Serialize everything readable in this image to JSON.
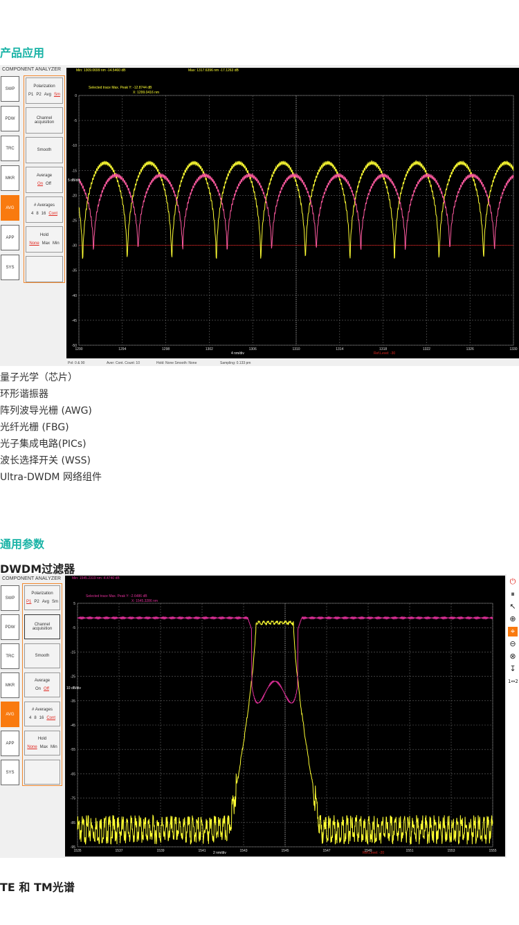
{
  "section_apps": "产品应用",
  "applications": [
    "量子光学（芯片）",
    "环形谐振器",
    "阵列波导光栅 (AWG)",
    "光纤光栅 (FBG)",
    "光子集成电路(PICs)",
    "波长选择开关 (WSS)",
    "Ultra-DWDM 网络组件"
  ],
  "section_params": "通用参数",
  "sub_dwdm": "DWDM过滤器",
  "sub_tetm": "TE 和 TM光谱",
  "app_title": "COMPONENT ANALYZER",
  "sidebar": [
    "SWP",
    "PDW",
    "TRC",
    "MKR",
    "AVG",
    "APP",
    "SYS"
  ],
  "colors": {
    "accent": "#f97a0f",
    "heading": "#19b3a6",
    "trace_yellow": "#ffff33",
    "trace_pink": "#ff5aa0",
    "trace_magenta": "#e2309a"
  },
  "screen1": {
    "controls": {
      "polarization": {
        "label": "Polarization",
        "options": [
          "P1",
          "P2",
          "Avg",
          "Sm"
        ],
        "selected": "Sm"
      },
      "channel": {
        "label": "Channel acquisition"
      },
      "smooth": {
        "label": "Smooth"
      },
      "average": {
        "label": "Average",
        "options": [
          "On",
          "Off"
        ],
        "selected": "On"
      },
      "averages": {
        "label": "# Averages",
        "options": [
          "4",
          "8",
          "16",
          "Cont"
        ],
        "selected": "Cont"
      },
      "hold": {
        "label": "Hold",
        "options": [
          "None",
          "Max",
          "Min"
        ],
        "selected": "None"
      }
    },
    "readout_min": "Min: 1309.0699 nm   -14.5460 dB",
    "readout_max": "Max: 1317.6396 nm   -17.1263 dB",
    "selected_line1": "Selected trace Max. Peak   Y: -12.8744 dB",
    "selected_line2": "X: 1299.0416 nm",
    "status_left": "Pol: 0 & 90",
    "status_aver": "Aver: Cont.   Count: 10",
    "status_hold": "Hold: None   Smooth: None",
    "status_sampling": "Sampling: 0.133 pm",
    "ref_level": "Ref.Level: -30",
    "x_unit": "4 nm/div",
    "y_unit": "5 dB/div",
    "chart_data": {
      "type": "line",
      "x_ticks": [
        "1290",
        "1294",
        "1298",
        "1302",
        "1306",
        "1310",
        "1314",
        "1318",
        "1322",
        "1326",
        "1330"
      ],
      "y_ticks": [
        "0",
        "-5",
        "-10",
        "-15",
        "-20",
        "-25",
        "-30",
        "-35",
        "-40",
        "-45",
        "-50"
      ],
      "xlim": [
        1290,
        1330
      ],
      "ylim": [
        -50,
        0
      ],
      "grid": true,
      "series": [
        {
          "color": "#ffff33",
          "period_nm": 4.1,
          "phase_nm": 1292.4,
          "peak_db": -13.5,
          "trough_db": -37.5
        },
        {
          "color": "#ff5aa0",
          "period_nm": 4.1,
          "phase_nm": 1293.4,
          "peak_db": -16.0,
          "trough_db": -34.5
        }
      ]
    }
  },
  "screen2": {
    "controls": {
      "polarization": {
        "label": "Polarization",
        "options": [
          "P1",
          "P2",
          "Avg",
          "Sm"
        ],
        "selected": "P1"
      },
      "channel": {
        "label": "Channel acquisition"
      },
      "smooth": {
        "label": "Smooth"
      },
      "average": {
        "label": "Average",
        "options": [
          "On",
          "Off"
        ],
        "selected": "Off"
      },
      "averages": {
        "label": "# Averages",
        "options": [
          "4",
          "8",
          "16",
          "Cont"
        ],
        "selected": "Cont"
      },
      "hold": {
        "label": "Hold",
        "options": [
          "None",
          "Max",
          "Min"
        ],
        "selected": "None"
      }
    },
    "readout_min": "Min: 1545.2319 nm   -4.4740 dB",
    "selected_line1": "Selected trace Max. Peak   Y: -2.6486 dB",
    "selected_line2": "X: 1545.3286 nm",
    "ref_level": "Ref.Level: -20",
    "x_unit": "2 nm/div",
    "y_unit": "10 dB/div",
    "tools": [
      "⏻",
      "⏸",
      "↖",
      "⊕",
      "⌖",
      "⊖",
      "⊗",
      "↧",
      "1↔2"
    ],
    "chart_data": {
      "type": "line",
      "x_ticks": [
        "1535",
        "1537",
        "1539",
        "1541",
        "1543",
        "1545",
        "1547",
        "1549",
        "1551",
        "1553",
        "1555"
      ],
      "y_ticks": [
        "5",
        "-5",
        "-15",
        "-25",
        "-35",
        "-45",
        "-55",
        "-65",
        "-75",
        "-85",
        "-95"
      ],
      "xlim": [
        1535,
        1555
      ],
      "ylim": [
        -95,
        5
      ],
      "grid": true,
      "series": [
        {
          "color": "#ffff33",
          "shape": "bandpass",
          "center_nm": 1544.5,
          "flat_db": -3,
          "floor_db": -88
        },
        {
          "color": "#e2309a",
          "shape": "notch",
          "center_nm": 1544.5,
          "flat_db": -1,
          "notch_db": -33
        }
      ]
    }
  }
}
